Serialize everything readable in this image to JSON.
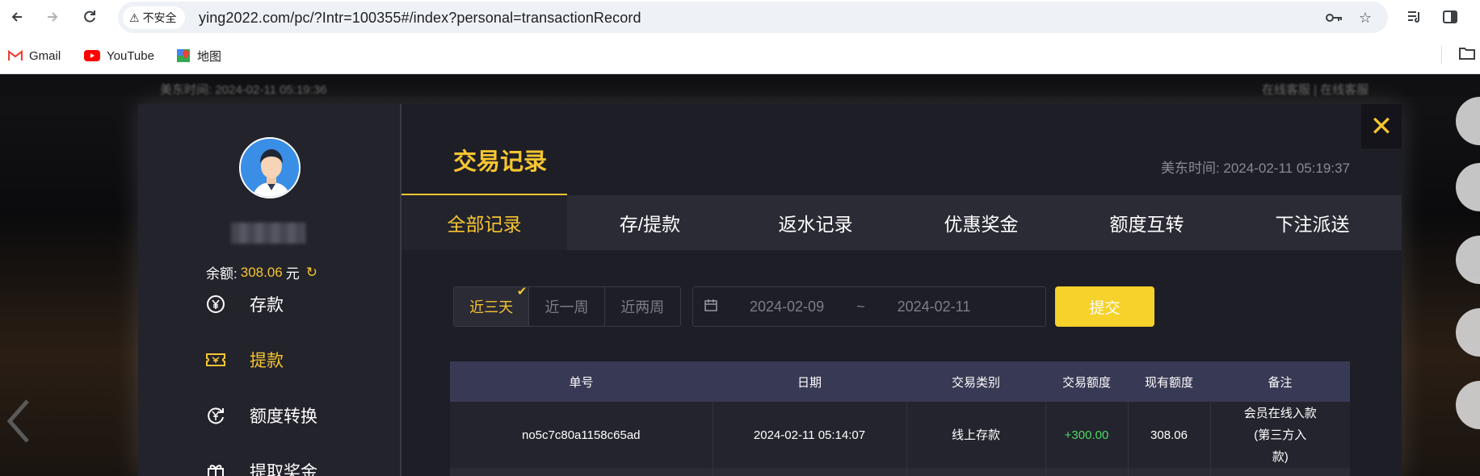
{
  "browser": {
    "security_label": "不安全",
    "url": "ying2022.com/pc/?Intr=100355#/index?personal=transactionRecord",
    "bookmarks": [
      {
        "label": "Gmail"
      },
      {
        "label": "YouTube"
      },
      {
        "label": "地图"
      }
    ]
  },
  "page": {
    "left_blur": "美东时间: 2024-02-11 05:19:36",
    "right_blur": "在线客服 | 在线客服"
  },
  "sidebar": {
    "balance_label": "余额:",
    "balance_amount": "308.06",
    "balance_unit": "元",
    "menu": [
      {
        "label": "存款",
        "icon": "yen-coin-icon"
      },
      {
        "label": "提款",
        "icon": "ticket-icon"
      },
      {
        "label": "额度转换",
        "icon": "exchange-coin-icon"
      },
      {
        "label": "提取奖金",
        "icon": "gift-icon"
      }
    ]
  },
  "main": {
    "title": "交易记录",
    "server_time": "美东时间: 2024-02-11 05:19:37",
    "tabs": [
      {
        "label": "全部记录"
      },
      {
        "label": "存/提款"
      },
      {
        "label": "返水记录"
      },
      {
        "label": "优惠奖金"
      },
      {
        "label": "额度互转"
      },
      {
        "label": "下注派送"
      }
    ],
    "ranges": [
      {
        "label": "近三天"
      },
      {
        "label": "近一周"
      },
      {
        "label": "近两周"
      }
    ],
    "date_from": "2024-02-09",
    "date_separator": "~",
    "date_to": "2024-02-11",
    "submit_label": "提交",
    "table": {
      "headers": [
        "单号",
        "日期",
        "交易类别",
        "交易额度",
        "现有额度",
        "备注"
      ],
      "rows": [
        {
          "order_no": "no5c7c80a1158c65ad",
          "date": "2024-02-11 05:14:07",
          "type": "线上存款",
          "amount": "+300.00",
          "balance": "308.06",
          "note_line1": "会员在线入款",
          "note_line2": "(第三方入",
          "note_line3": "款)"
        }
      ]
    }
  },
  "colors": {
    "accent": "#f6c530",
    "positive": "#4cd964"
  }
}
